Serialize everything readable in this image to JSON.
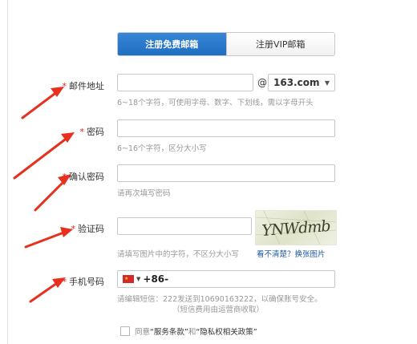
{
  "tabs": {
    "free": "注册免费邮箱",
    "vip": "注册VIP邮箱"
  },
  "required_mark": "*",
  "email": {
    "label": "邮件地址",
    "value": "",
    "at": "@",
    "domain": "163.com",
    "hint": "6~18个字符，可使用字母、数字、下划线，需以字母开头"
  },
  "password": {
    "label": "密码",
    "value": "",
    "hint": "6~16个字符，区分大小写"
  },
  "confirm_password": {
    "label": "确认密码",
    "value": "",
    "hint": "请再次填写密码"
  },
  "captcha": {
    "label": "验证码",
    "value": "",
    "hint": "请填写图片中的字符，不区分大小写",
    "image_text": "YNWdmb",
    "refresh_link": "看不清楚？换张图片"
  },
  "phone": {
    "label": "手机号码",
    "country_code": "+86-",
    "hint_line1": "请编辑短信：222发送到10690163222，以确保账号安全。",
    "hint_line2": "（短信费用由运营商收取）"
  },
  "agreement": {
    "prefix": "同意",
    "terms": "“服务条款”",
    "and": "和",
    "privacy": "“隐私权相关政策”"
  },
  "colors": {
    "tab_active": "#2a7ccd",
    "required": "#e02020",
    "arrow": "#e8301e",
    "link": "#1d57a6"
  }
}
